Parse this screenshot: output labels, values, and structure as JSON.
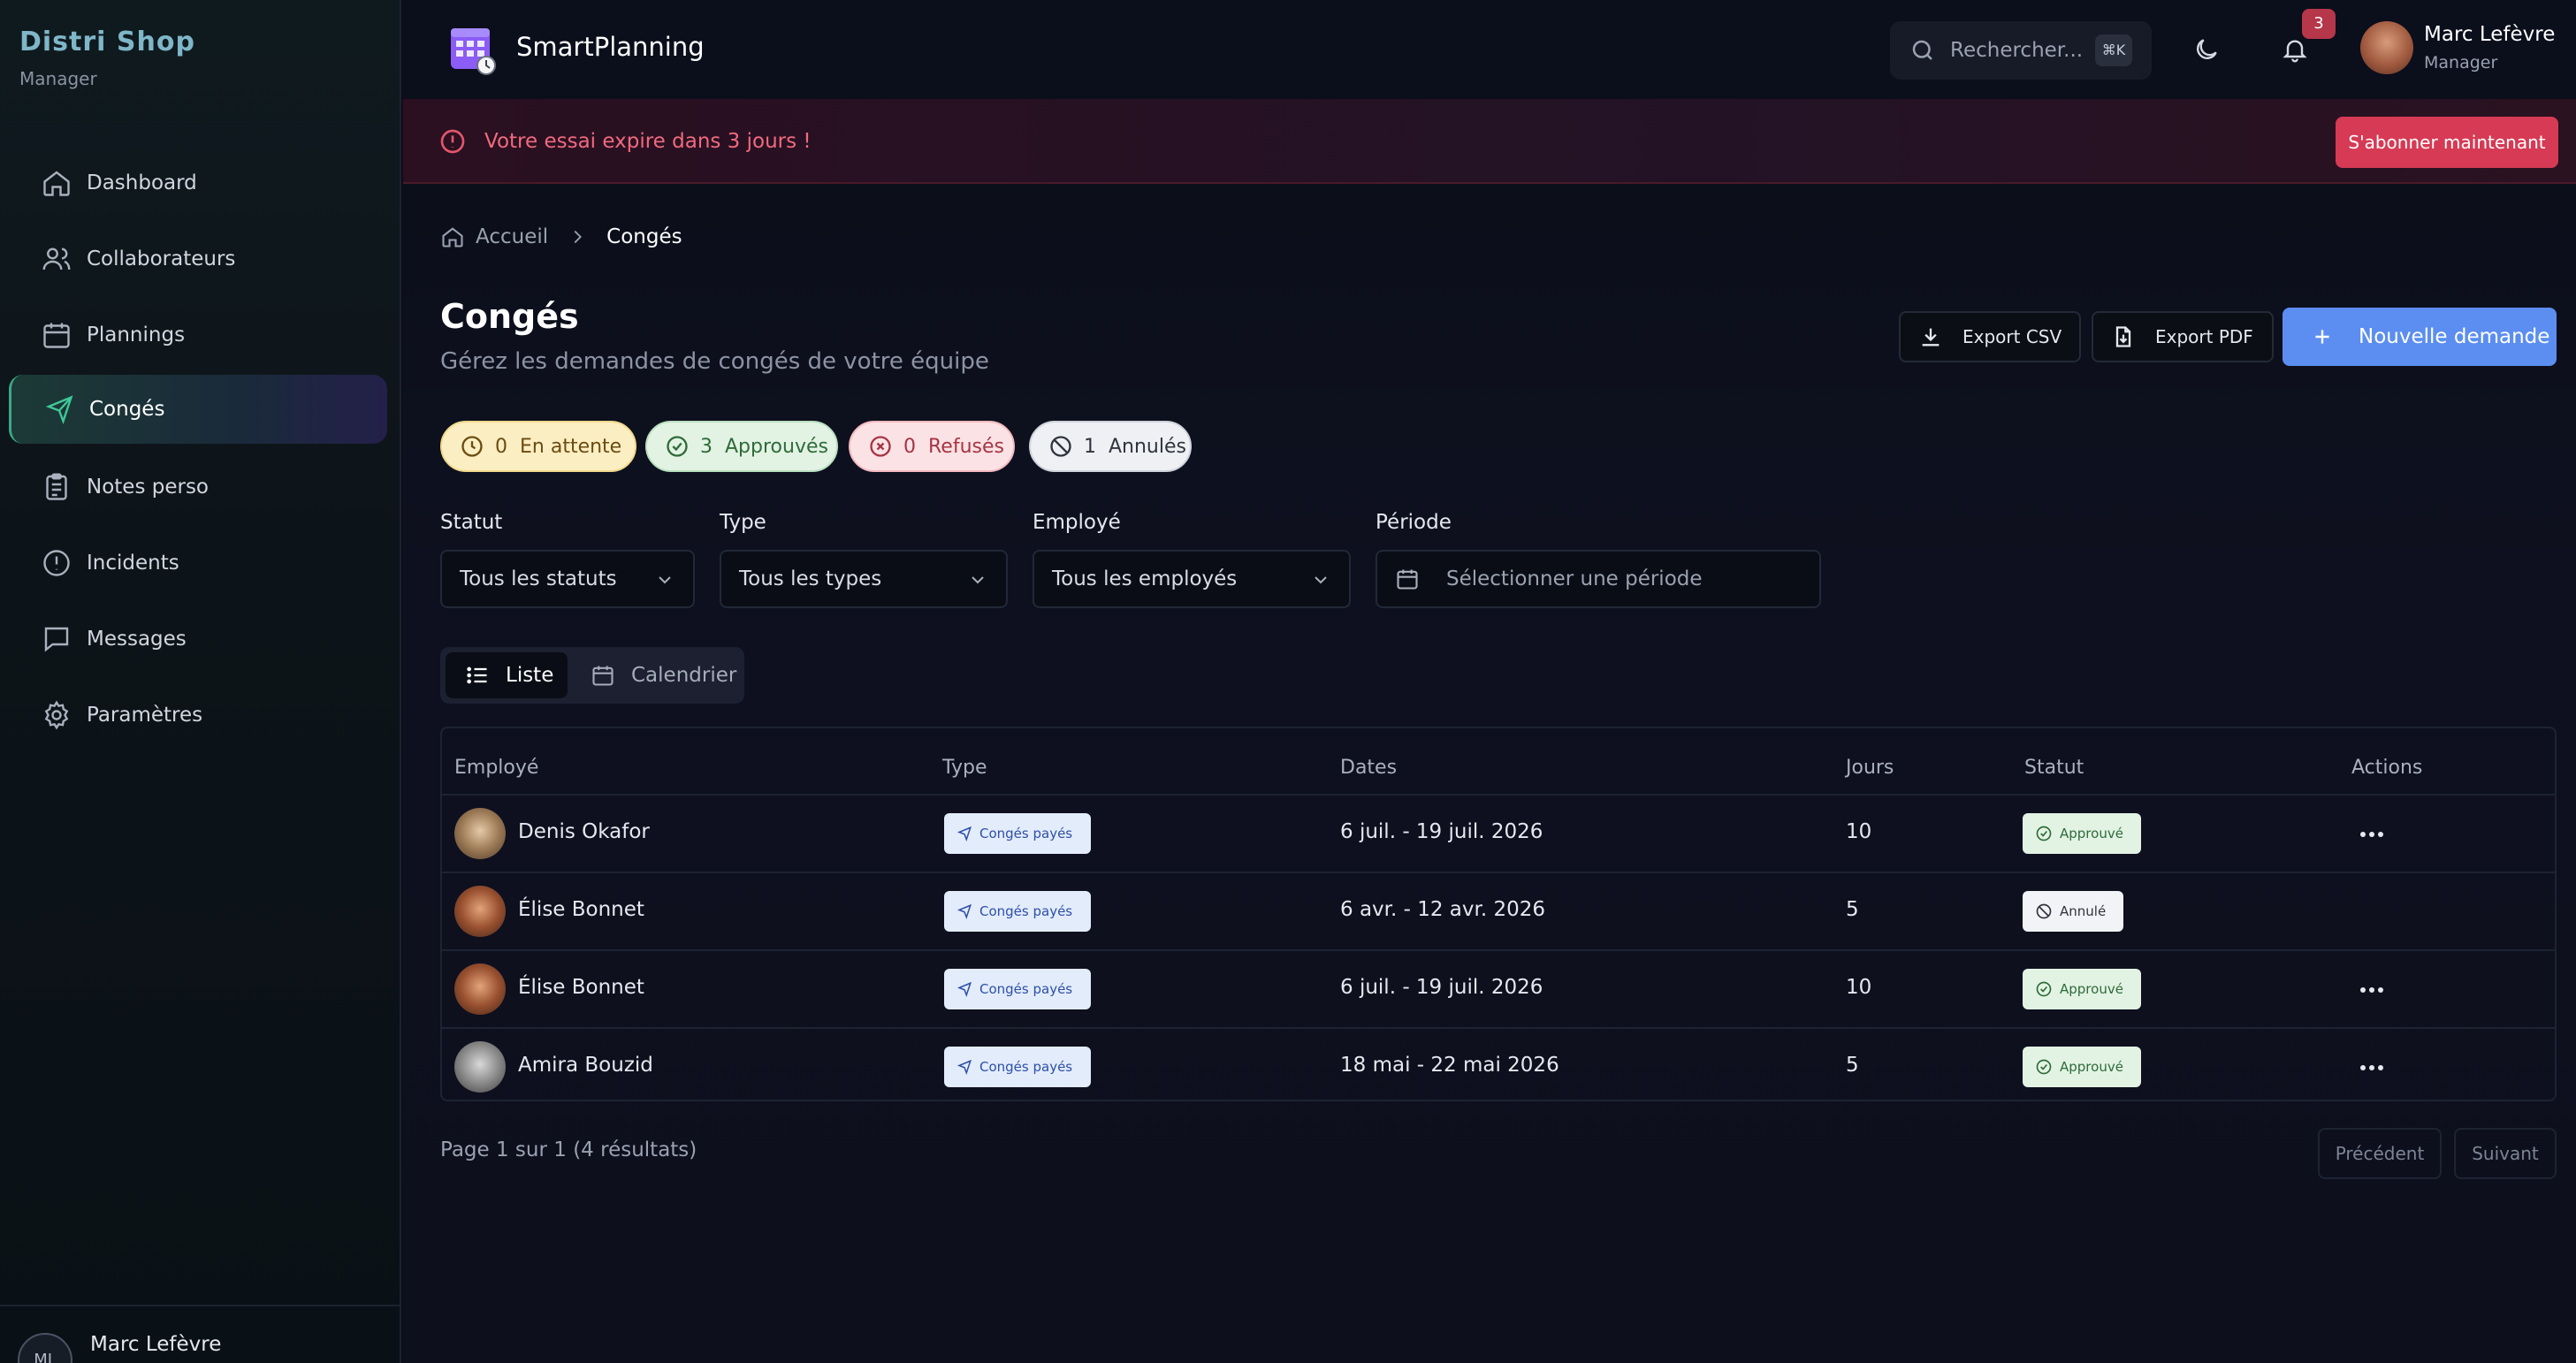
{
  "sidebar": {
    "brand": "Distri Shop",
    "role": "Manager",
    "items": [
      {
        "label": "Dashboard",
        "icon": "home-icon"
      },
      {
        "label": "Collaborateurs",
        "icon": "users-icon"
      },
      {
        "label": "Plannings",
        "icon": "calendar-icon"
      },
      {
        "label": "Congés",
        "icon": "plane-icon",
        "active": true
      },
      {
        "label": "Notes perso",
        "icon": "clipboard-icon"
      },
      {
        "label": "Incidents",
        "icon": "alert-circle-icon"
      },
      {
        "label": "Messages",
        "icon": "message-icon"
      },
      {
        "label": "Paramètres",
        "icon": "gear-icon"
      }
    ],
    "user": {
      "initials": "ML",
      "name": "Marc Lefèvre"
    }
  },
  "header": {
    "app_title": "SmartPlanning",
    "search_placeholder": "Rechercher...",
    "search_shortcut": "⌘K",
    "notifications_count": "3",
    "user_name": "Marc Lefèvre",
    "user_role": "Manager"
  },
  "banner": {
    "message": "Votre essai expire dans 3 jours !",
    "cta": "S'abonner maintenant"
  },
  "breadcrumb": {
    "home": "Accueil",
    "current": "Congés"
  },
  "page": {
    "title": "Congés",
    "subtitle": "Gérez les demandes de congés de votre équipe",
    "export_csv": "Export CSV",
    "export_pdf": "Export PDF",
    "new_request": "Nouvelle demande"
  },
  "status_chips": [
    {
      "count": "0",
      "label": "En attente"
    },
    {
      "count": "3",
      "label": "Approuvés"
    },
    {
      "count": "0",
      "label": "Refusés"
    },
    {
      "count": "1",
      "label": "Annulés"
    }
  ],
  "filters": {
    "status": {
      "label": "Statut",
      "value": "Tous les statuts"
    },
    "type": {
      "label": "Type",
      "value": "Tous les types"
    },
    "employee": {
      "label": "Employé",
      "value": "Tous les employés"
    },
    "period": {
      "label": "Période",
      "placeholder": "Sélectionner une période"
    }
  },
  "view_toggle": {
    "list": "Liste",
    "calendar": "Calendrier"
  },
  "table": {
    "columns": [
      "Employé",
      "Type",
      "Dates",
      "Jours",
      "Statut",
      "Actions"
    ],
    "rows": [
      {
        "employee": "Denis Okafor",
        "type": "Congés payés",
        "dates": "6 juil. - 19 juil. 2026",
        "days": "10",
        "status": "Approuvé"
      },
      {
        "employee": "Élise Bonnet",
        "type": "Congés payés",
        "dates": "6 avr. - 12 avr. 2026",
        "days": "5",
        "status": "Annulé"
      },
      {
        "employee": "Élise Bonnet",
        "type": "Congés payés",
        "dates": "6 juil. - 19 juil. 2026",
        "days": "10",
        "status": "Approuvé"
      },
      {
        "employee": "Amira Bouzid",
        "type": "Congés payés",
        "dates": "18 mai - 22 mai 2026",
        "days": "5",
        "status": "Approuvé"
      }
    ]
  },
  "pagination": {
    "summary": "Page 1 sur 1 (4 résultats)",
    "prev": "Précédent",
    "next": "Suivant"
  },
  "colors": {
    "accent": "#5b8ef0",
    "danger": "#d63a54",
    "success": "#3fc795"
  }
}
